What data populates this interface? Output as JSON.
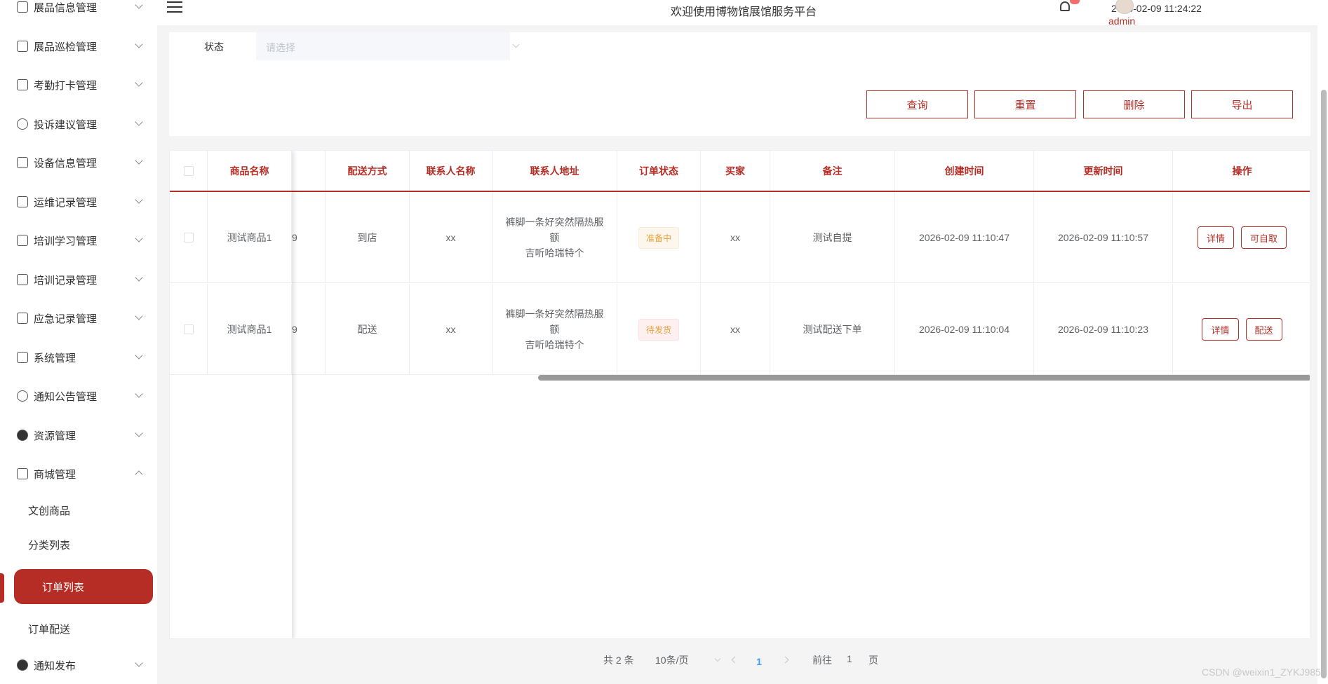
{
  "header": {
    "title": "欢迎使用博物馆展馆服务平台",
    "datetime": "2026-02-09 11:24:22",
    "username": "admin"
  },
  "sidebar": {
    "items": [
      {
        "label": "展品信息管理",
        "icon": "tablet-icon"
      },
      {
        "label": "展品巡检管理",
        "icon": "copy-icon"
      },
      {
        "label": "考勤打卡管理",
        "icon": "document-icon"
      },
      {
        "label": "投诉建议管理",
        "icon": "paperclip-icon"
      },
      {
        "label": "设备信息管理",
        "icon": "folder-icon"
      },
      {
        "label": "运维记录管理",
        "icon": "notebook-icon"
      },
      {
        "label": "培训学习管理",
        "icon": "lock-icon"
      },
      {
        "label": "培训记录管理",
        "icon": "camera-icon"
      },
      {
        "label": "应急记录管理",
        "icon": "alarm-list-icon"
      },
      {
        "label": "系统管理",
        "icon": "picture-icon"
      },
      {
        "label": "通知公告管理",
        "icon": "warning-circle-icon"
      },
      {
        "label": "资源管理",
        "icon": "bulb-icon"
      },
      {
        "label": "商城管理",
        "icon": "cart-icon"
      }
    ],
    "submenu": [
      "文创商品",
      "分类列表",
      "订单列表",
      "订单配送"
    ],
    "last_item": "通知发布"
  },
  "search": {
    "status_label": "状态",
    "status_placeholder": "请选择",
    "buttons": {
      "query": "查询",
      "reset": "重置",
      "delete": "删除",
      "export": "导出"
    }
  },
  "table": {
    "headers": {
      "product_name": "商品名称",
      "delivery": "配送方式",
      "contact_name": "联系人名称",
      "contact_addr": "联系人地址",
      "order_status": "订单状态",
      "buyer": "买家",
      "remark": "备注",
      "created": "创建时间",
      "updated": "更新时间",
      "ops": "操作"
    },
    "rows": [
      {
        "product_name": "测试商品1",
        "partial": "9",
        "delivery": "到店",
        "contact_name": "xx",
        "contact_addr_line1": "裤脚一条好突然隔热服额",
        "contact_addr_line2": "吉听哈瑞特个",
        "order_status": "准备中",
        "buyer": "xx",
        "remark": "测试自提",
        "created": "2026-02-09 11:10:47",
        "updated": "2026-02-09 11:10:57",
        "op1": "详情",
        "op2": "可自取"
      },
      {
        "product_name": "测试商品1",
        "partial": "9",
        "delivery": "配送",
        "contact_name": "xx",
        "contact_addr_line1": "裤脚一条好突然隔热服额",
        "contact_addr_line2": "吉听哈瑞特个",
        "order_status": "待发货",
        "buyer": "xx",
        "remark": "测试配送下单",
        "created": "2026-02-09 11:10:04",
        "updated": "2026-02-09 11:10:23",
        "op1": "详情",
        "op2": "配送"
      }
    ]
  },
  "pagination": {
    "total": "共 2 条",
    "page_size": "10条/页",
    "current": "1",
    "goto_prefix": "前往",
    "goto_value": "1",
    "goto_suffix": "页"
  },
  "watermark": "CSDN @weixin1_ZYKJ985",
  "colors": {
    "accent": "#b52d25",
    "pending_tag": "#e6a23c"
  }
}
